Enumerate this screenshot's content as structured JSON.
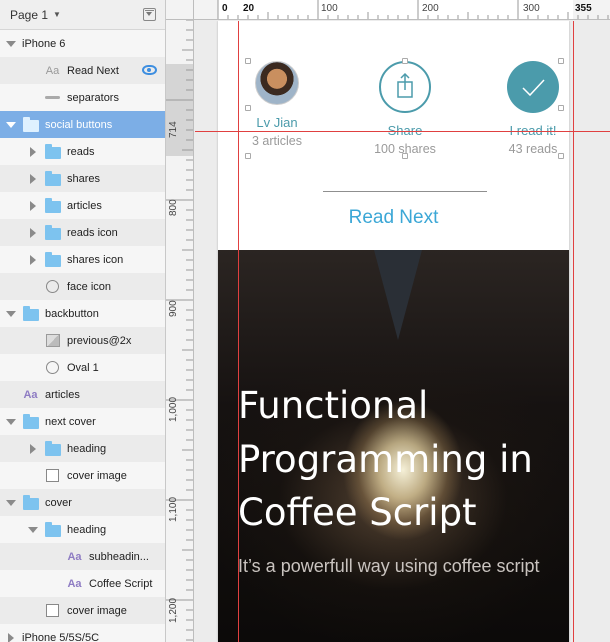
{
  "sidebar": {
    "page_label": "Page 1",
    "layers": [
      {
        "label": "iPhone 6",
        "indent": 0,
        "arrow": "down",
        "icon": "none"
      },
      {
        "label": "Read Next",
        "indent": 1,
        "arrow": "none",
        "icon": "text-grey",
        "icon_text": "Aa",
        "visible_eye": true
      },
      {
        "label": "separators",
        "indent": 1,
        "arrow": "none",
        "icon": "line"
      },
      {
        "label": "social buttons",
        "indent": 0,
        "arrow": "down",
        "icon": "folder",
        "selected": true
      },
      {
        "label": "reads",
        "indent": 1,
        "arrow": "right",
        "icon": "folder"
      },
      {
        "label": "shares",
        "indent": 1,
        "arrow": "right",
        "icon": "folder"
      },
      {
        "label": "articles",
        "indent": 1,
        "arrow": "right",
        "icon": "folder"
      },
      {
        "label": "reads icon",
        "indent": 1,
        "arrow": "right",
        "icon": "folder"
      },
      {
        "label": "shares icon",
        "indent": 1,
        "arrow": "right",
        "icon": "folder"
      },
      {
        "label": "face icon",
        "indent": 1,
        "arrow": "none",
        "icon": "oval"
      },
      {
        "label": "backbutton",
        "indent": 0,
        "arrow": "down",
        "icon": "folder"
      },
      {
        "label": "previous@2x",
        "indent": 1,
        "arrow": "none",
        "icon": "image"
      },
      {
        "label": "Oval 1",
        "indent": 1,
        "arrow": "none",
        "icon": "oval"
      },
      {
        "label": "articles",
        "indent": 0,
        "arrow": "none",
        "icon": "text",
        "icon_text": "Aa"
      },
      {
        "label": "next cover",
        "indent": 0,
        "arrow": "down",
        "icon": "folder"
      },
      {
        "label": "heading",
        "indent": 1,
        "arrow": "right",
        "icon": "folder"
      },
      {
        "label": "cover image",
        "indent": 1,
        "arrow": "none",
        "icon": "square"
      },
      {
        "label": "cover",
        "indent": 0,
        "arrow": "down",
        "icon": "folder"
      },
      {
        "label": "heading",
        "indent": 1,
        "arrow": "down",
        "icon": "folder"
      },
      {
        "label": "subheadin...",
        "indent": 2,
        "arrow": "none",
        "icon": "text",
        "icon_text": "Aa"
      },
      {
        "label": "Coffee Script",
        "indent": 2,
        "arrow": "none",
        "icon": "text",
        "icon_text": "Aa"
      },
      {
        "label": "cover image",
        "indent": 1,
        "arrow": "none",
        "icon": "square"
      },
      {
        "label": "iPhone 5/5S/5C",
        "indent": 0,
        "arrow": "right",
        "icon": "none"
      }
    ]
  },
  "ruler": {
    "top_labels": [
      "0",
      "20",
      "100",
      "200",
      "300",
      "355"
    ],
    "left_labels": [
      "714",
      "800",
      "900",
      "1,000",
      "1,100",
      "1,200"
    ]
  },
  "artboard": {
    "social": [
      {
        "name": "Lv Jian",
        "count": "3 articles",
        "icon": "avatar-icon"
      },
      {
        "name": "Share",
        "count": "100 shares",
        "icon": "share-icon"
      },
      {
        "name": "I read it!",
        "count": "43 reads",
        "icon": "check-icon"
      }
    ],
    "read_next": "Read Next",
    "cover": {
      "heading": "Functional Programming in Coffee Script",
      "subheading": "It’s a powerfull way using coffee script"
    }
  },
  "colors": {
    "accent": "#4b9bab",
    "link": "#3ba7d6",
    "selection": "#7caee6",
    "guide": "#e04040"
  }
}
